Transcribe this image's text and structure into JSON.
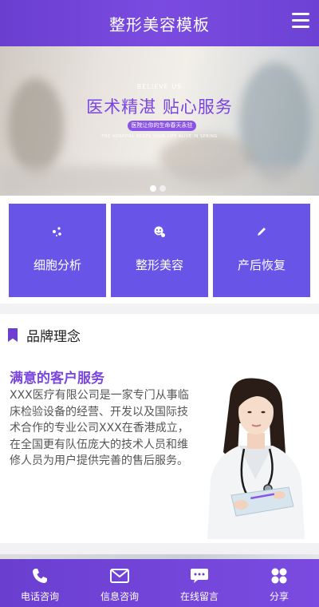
{
  "header": {
    "title": "整形美容模板",
    "menu_icon": "hamburger-menu-icon"
  },
  "banner": {
    "eyebrow": "BELIEVE US",
    "slogan": "医术精湛 贴心服务",
    "pill": "医院让你的生命春天永驻",
    "small": "THE HOSPITAL KEEPS YOUR LIFE ALIVE IN SPRING",
    "slides": 2,
    "active_slide": 1
  },
  "services": [
    {
      "label": "细胞分析",
      "icon": "cell-icon"
    },
    {
      "label": "整形美容",
      "icon": "face-icon"
    },
    {
      "label": "产后恢复",
      "icon": "pen-icon"
    }
  ],
  "brand": {
    "heading": "品牌理念",
    "subtitle": "满意的客户服务",
    "description": "XXX医疗有限公司是一家专门从事临床检验设备的经营、开发以及国际技术合作的专业公司XXX在香港成立，在全国更有队伍庞大的技术人员和维修人员为用户提供完善的售后服务。"
  },
  "footer": [
    {
      "label": "电话咨询",
      "icon": "phone-icon"
    },
    {
      "label": "信息咨询",
      "icon": "mail-icon"
    },
    {
      "label": "在线留言",
      "icon": "chat-icon"
    },
    {
      "label": "分享",
      "icon": "share-icon"
    }
  ],
  "colors": {
    "primary": "#6a3fd0",
    "tile": "#6855e8",
    "accent_text": "#7a45e0"
  }
}
